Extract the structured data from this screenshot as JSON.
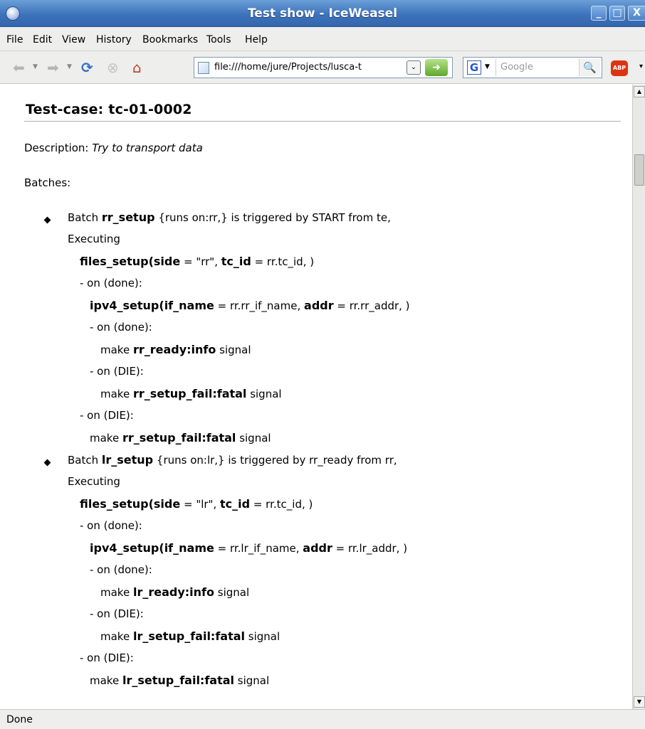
{
  "window": {
    "title": "Test show - IceWeasel",
    "minimize": "_",
    "maximize": "□",
    "close": "X"
  },
  "menu": [
    "File",
    "Edit",
    "View",
    "History",
    "Bookmarks",
    "Tools",
    "Help"
  ],
  "toolbar": {
    "url": "file:///home/jure/Projects/lusca-t",
    "search_placeholder": "Google",
    "search_engine_icon": "G",
    "addon_label": "ABP"
  },
  "page": {
    "title": "Test-case: tc-01-0002",
    "description_label": "Description:",
    "description_value": "Try to transport data",
    "batches_label": "Batches:"
  },
  "lines": [
    {
      "text_parts": [
        "Batch ",
        "rr_setup",
        " {runs on:rr,} is triggered by START from te,"
      ]
    },
    {
      "text_parts": [
        "Executing"
      ]
    },
    {
      "text_parts": [
        "files_setup",
        "(",
        "side",
        " = \"rr\", ",
        "tc_id",
        " = rr.tc_id, )"
      ]
    },
    {
      "text_parts": [
        "- on (done):"
      ]
    },
    {
      "text_parts": [
        "ipv4_setup",
        "(",
        "if_name",
        " = rr.rr_if_name, ",
        "addr",
        " = rr.rr_addr, )"
      ]
    },
    {
      "text_parts": [
        "- on (done):"
      ]
    },
    {
      "text_parts": [
        "make ",
        "rr_ready:info",
        " signal"
      ]
    },
    {
      "text_parts": [
        "- on (DIE):"
      ]
    },
    {
      "text_parts": [
        "make ",
        "rr_setup_fail:fatal",
        " signal"
      ]
    },
    {
      "text_parts": [
        "- on (DIE):"
      ]
    },
    {
      "text_parts": [
        "make ",
        "rr_setup_fail:fatal",
        " signal"
      ]
    },
    {
      "text_parts": [
        "Batch ",
        "lr_setup",
        " {runs on:lr,} is triggered by rr_ready from rr,"
      ]
    },
    {
      "text_parts": [
        "Executing"
      ]
    },
    {
      "text_parts": [
        "files_setup",
        "(",
        "side",
        " = \"lr\", ",
        "tc_id",
        " = rr.tc_id, )"
      ]
    },
    {
      "text_parts": [
        "- on (done):"
      ]
    },
    {
      "text_parts": [
        "ipv4_setup",
        "(",
        "if_name",
        " = rr.lr_if_name, ",
        "addr",
        " = rr.lr_addr, )"
      ]
    },
    {
      "text_parts": [
        "- on (done):"
      ]
    },
    {
      "text_parts": [
        "make ",
        "lr_ready:info",
        " signal"
      ]
    },
    {
      "text_parts": [
        "- on (DIE):"
      ]
    },
    {
      "text_parts": [
        "make ",
        "lr_setup_fail:fatal",
        " signal"
      ]
    },
    {
      "text_parts": [
        "- on (DIE):"
      ]
    },
    {
      "text_parts": [
        "make ",
        "lr_setup_fail:fatal",
        " signal"
      ]
    }
  ],
  "status": {
    "text": "Done"
  },
  "icons": {
    "back": "back-arrow-icon",
    "forward": "forward-arrow-icon",
    "reload": "reload-icon",
    "stop": "stop-icon",
    "home": "home-icon",
    "go": "go-arrow-icon",
    "search": "magnifier-icon"
  }
}
